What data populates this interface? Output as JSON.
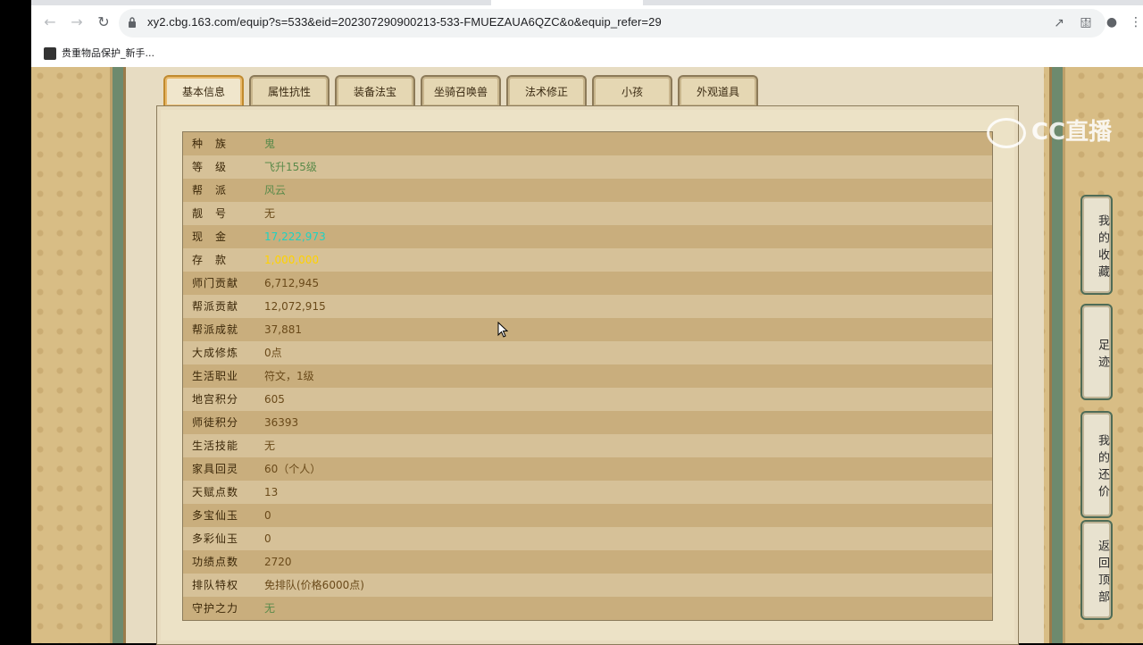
{
  "browser": {
    "url": "xy2.cbg.163.com/equip?s=533&eid=202307290900213-533-FMUEZAUA6QZC&o&equip_refer=29",
    "bookmark_label": "贵重物品保护_新手..."
  },
  "tabs": [
    {
      "label": "基本信息",
      "active": true
    },
    {
      "label": "属性抗性",
      "active": false
    },
    {
      "label": "装备法宝",
      "active": false
    },
    {
      "label": "坐骑召唤兽",
      "active": false
    },
    {
      "label": "法术修正",
      "active": false
    },
    {
      "label": "小孩",
      "active": false
    },
    {
      "label": "外观道具",
      "active": false
    }
  ],
  "info_rows": [
    {
      "label": "种　族",
      "value": "鬼",
      "color": "#5a8a4a"
    },
    {
      "label": "等　级",
      "value": "飞升155级",
      "color": "#5a8a4a"
    },
    {
      "label": "帮　派",
      "value": "风云",
      "color": "#5a8a4a"
    },
    {
      "label": "靓　号",
      "value": "无",
      "color": "#6a4a1a"
    },
    {
      "label": "现　金",
      "value": "17,222,973",
      "color": "#1fd2c2"
    },
    {
      "label": "存　款",
      "value": "1,000,000",
      "color": "#ffd200"
    },
    {
      "label": "师门贡献",
      "value": "6,712,945",
      "color": "#6a4a1a"
    },
    {
      "label": "帮派贡献",
      "value": "12,072,915",
      "color": "#6a4a1a"
    },
    {
      "label": "帮派成就",
      "value": "37,881",
      "color": "#6a4a1a"
    },
    {
      "label": "大成修炼",
      "value": "0点",
      "color": "#6a4a1a"
    },
    {
      "label": "生活职业",
      "value": "符文，1级",
      "color": "#6a4a1a"
    },
    {
      "label": "地宫积分",
      "value": "605",
      "color": "#6a4a1a"
    },
    {
      "label": "师徒积分",
      "value": "36393",
      "color": "#6a4a1a"
    },
    {
      "label": "生活技能",
      "value": "无",
      "color": "#6a4a1a"
    },
    {
      "label": "家具回灵",
      "value": "60（个人）",
      "color": "#6a4a1a"
    },
    {
      "label": "天赋点数",
      "value": "13",
      "color": "#6a4a1a"
    },
    {
      "label": "多宝仙玉",
      "value": "0",
      "color": "#6a4a1a"
    },
    {
      "label": "多彩仙玉",
      "value": "0",
      "color": "#6a4a1a"
    },
    {
      "label": "功绩点数",
      "value": "2720",
      "color": "#6a4a1a"
    },
    {
      "label": "排队特权",
      "value": "免排队(价格6000点)",
      "color": "#6a4a1a"
    },
    {
      "label": "守护之力",
      "value": "无",
      "color": "#5a8a4a"
    }
  ],
  "side_buttons": [
    {
      "label": "我的收藏"
    },
    {
      "label": "足迹"
    },
    {
      "label": "我的还价"
    },
    {
      "label": "返回顶部"
    }
  ],
  "watermark_text": "CC直播"
}
